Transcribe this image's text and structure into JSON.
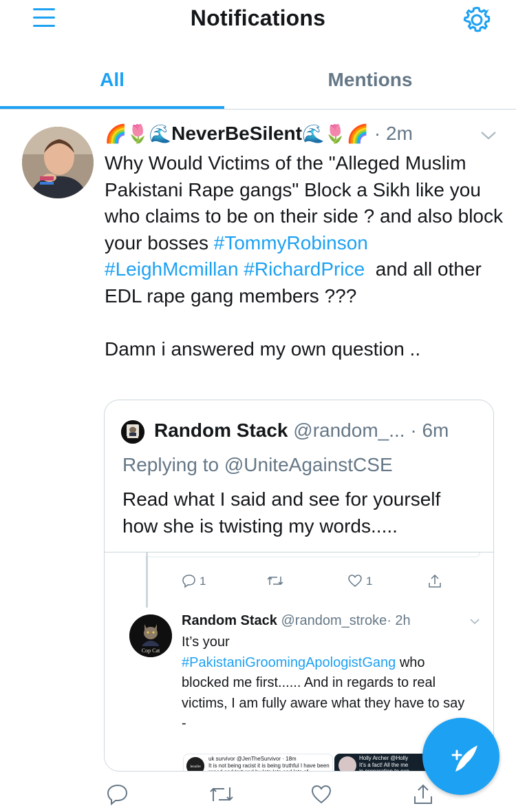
{
  "header": {
    "title": "Notifications"
  },
  "tabs": [
    {
      "label": "All"
    },
    {
      "label": "Mentions"
    }
  ],
  "tweet": {
    "emoji_left": "🌈🌷🌊",
    "name": "NeverBeSilent",
    "emoji_right": "🌊🌷🌈",
    "time": "· 2m",
    "text_1": "Why Would Victims of the \"Alleged Muslim Pakistani Rape gangs\" Block a Sikh like you who claims to be on their side ? and also block your bosses ",
    "tag_1": "#TommyRobinson",
    "tag_2": "#LeighMcmillan",
    "tag_3": "#RichardPrice",
    "text_2": "  and all other EDL rape gang members ???\n\nDamn i answered my own question .."
  },
  "quote": {
    "name": "Random Stack",
    "handle": "@random_...",
    "time": "· 6m",
    "replying": "Replying to @UniteAgainstCSE",
    "text": "Read what I said and see for yourself how she is twisting my words....."
  },
  "screenshot": {
    "reply_count": "1",
    "like_count": "1",
    "avatar_caption": "Cop Cat",
    "name": "Random Stack",
    "handle": "@random_stroke",
    "time": "· 2h",
    "text_1": "It’s your\n",
    "tag": "#PakistaniGroomingApologistGang",
    "text_2": " who blocked me first...... And in regards to real victims, I am fully aware what they have to say -",
    "mini1_text": "uk survivor @JenTheSurvivor · 18m\nIt is not being racist it is being truthful I have been raped and tortured by lots lots and lots of Pakistani men He got lots of",
    "mini1_avatar": "Jennifer",
    "mini2_text": "Holly Archer @Holly\nIt's a fact! All the me\nin preparation to exp"
  },
  "colors": {
    "accent": "#1da1f2",
    "muted": "#657786",
    "border": "#ccd6dd",
    "text": "#14171a"
  }
}
